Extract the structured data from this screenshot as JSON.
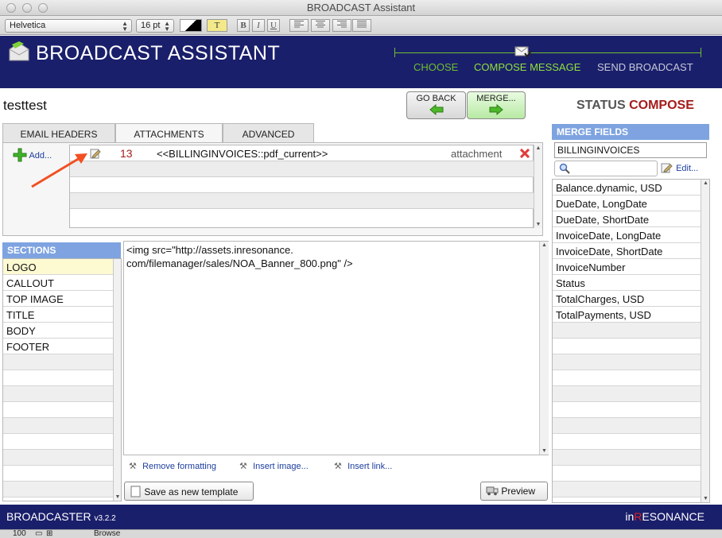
{
  "window": {
    "title": "BROADCAST Assistant"
  },
  "format_toolbar": {
    "font": "Helvetica",
    "size": "16 pt",
    "text_color_button": "T",
    "bold": "B",
    "italic": "I",
    "underline": "U"
  },
  "header": {
    "app_title": "BROADCAST ASSISTANT",
    "steps": [
      {
        "label": "CHOOSE",
        "color": "#6fbf2e"
      },
      {
        "label": "COMPOSE MESSAGE",
        "color": "#8fe03a"
      },
      {
        "label": "SEND BROADCAST",
        "color": "#c6c9d8"
      }
    ]
  },
  "record": {
    "name": "testtest",
    "go_back_label": "GO BACK",
    "merge_label": "MERGE...",
    "status_label": "STATUS",
    "status_value": "COMPOSE"
  },
  "tabs": [
    {
      "label": "EMAIL HEADERS",
      "active": false
    },
    {
      "label": "ATTACHMENTS",
      "active": true
    },
    {
      "label": "ADVANCED",
      "active": false
    }
  ],
  "attachments": {
    "add_label": "Add...",
    "rows": [
      {
        "number": "13",
        "name": "<<BILLINGINVOICES::pdf_current>>",
        "type": "attachment"
      }
    ]
  },
  "sections": {
    "header": "SECTIONS",
    "items": [
      "LOGO",
      "CALLOUT",
      "TOP IMAGE",
      "TITLE",
      "BODY",
      "FOOTER"
    ],
    "selected": "LOGO"
  },
  "editor": {
    "content_line1": "<img src=\"http://assets.inresonance.",
    "content_line2": "com/filemanager/sales/NOA_Banner_800.png\" />",
    "remove_formatting": "Remove formatting",
    "insert_image": "Insert image...",
    "insert_link": "Insert link...",
    "save_template": "Save as new template",
    "preview": "Preview"
  },
  "merge_fields": {
    "header": "MERGE FIELDS",
    "table": "BILLINGINVOICES",
    "edit_label": "Edit...",
    "fields": [
      "Balance.dynamic, USD",
      "DueDate, LongDate",
      "DueDate, ShortDate",
      "InvoiceDate, LongDate",
      "InvoiceDate, ShortDate",
      "InvoiceNumber",
      "Status",
      "TotalCharges, USD",
      "TotalPayments, USD"
    ]
  },
  "footer": {
    "brand": "BROADCASTER",
    "version": "v3.2.2",
    "company_prefix": "in",
    "company_r": "R",
    "company_rest": "ESONANCE"
  },
  "status_bar": {
    "zoom": "100",
    "mode": "Browse"
  }
}
